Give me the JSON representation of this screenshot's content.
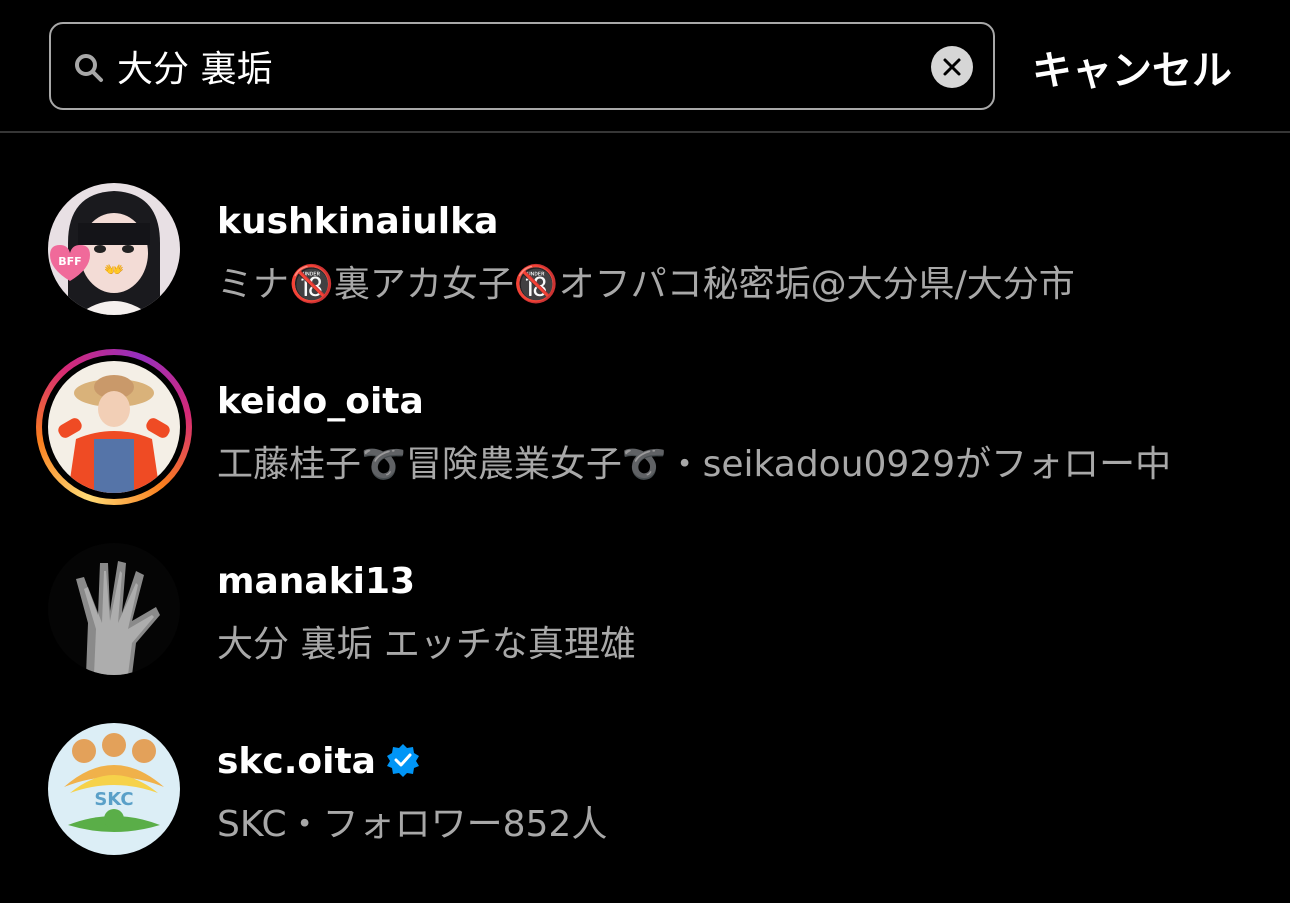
{
  "search": {
    "value": "大分 裏垢",
    "cancel_label": "キャンセル"
  },
  "results": [
    {
      "username": "kushkinaiulka",
      "subtitle": "ミナ🔞裏アカ女子🔞オフパコ秘密垢@大分県/大分市",
      "avatar_badge_text": "BFF"
    },
    {
      "username": "keido_oita",
      "subtitle": "工藤桂子➰冒険農業女子➰・seikadou0929がフォロー中"
    },
    {
      "username": "manaki13",
      "subtitle": "大分 裏垢 エッチな真理雄"
    },
    {
      "username": "skc.oita",
      "subtitle": "SKC・フォロワー852人",
      "verified": true,
      "avatar_logo_text": "SKC"
    }
  ],
  "colors": {
    "background": "#000000",
    "secondary_text": "#a8a8a8",
    "verified_badge": "#0095f6"
  }
}
